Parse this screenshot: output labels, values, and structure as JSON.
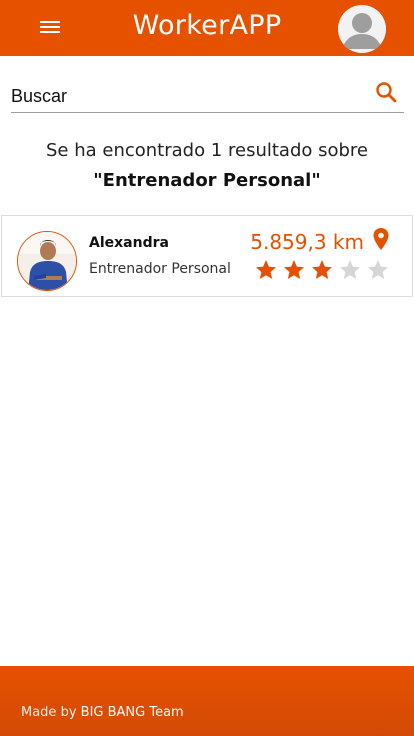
{
  "header": {
    "title": "WorkerAPP",
    "menu_icon": "hamburger-menu-icon",
    "avatar_icon": "user-avatar-icon"
  },
  "search": {
    "placeholder": "Buscar",
    "icon": "search-icon"
  },
  "results": {
    "count_text": "Se ha encontrado 1 resultado sobre",
    "query_text": "\"Entrenador Personal\"",
    "items": [
      {
        "name": "Alexandra",
        "role": "Entrenador Personal",
        "distance": "5.859,3 km",
        "rating": 3,
        "max_rating": 5
      }
    ]
  },
  "footer": {
    "prefix": "Made by",
    "team": "BIG BANG Team"
  },
  "colors": {
    "brand": "#e65100",
    "star_filled": "#e65100",
    "star_empty": "#d6d6d6"
  }
}
